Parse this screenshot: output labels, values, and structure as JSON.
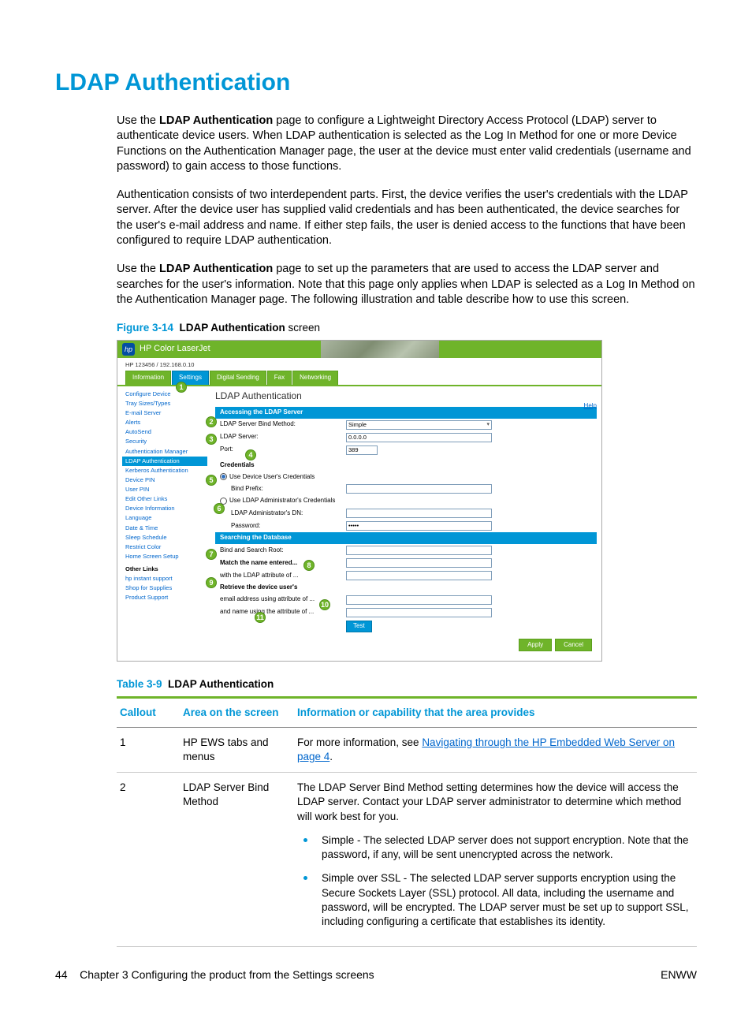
{
  "page": {
    "title": "LDAP Authentication",
    "para1_a": "Use the ",
    "para1_bold": "LDAP Authentication",
    "para1_b": " page to configure a Lightweight Directory Access Protocol (LDAP) server to authenticate device users. When LDAP authentication is selected as the Log In Method for one or more Device Functions on the Authentication Manager page, the user at the device must enter valid credentials (username and password) to gain access to those functions.",
    "para2": "Authentication consists of two interdependent parts. First, the device verifies the user's credentials with the LDAP server. After the device user has supplied valid credentials and has been authenticated, the device searches for the user's e-mail address and name. If either step fails, the user is denied access to the functions that have been configured to require LDAP authentication.",
    "para3_a": "Use the ",
    "para3_bold": "LDAP Authentication",
    "para3_b": " page to set up the parameters that are used to access the LDAP server and searches for the user's information. Note that this page only applies when LDAP is selected as a Log In Method on the Authentication Manager page. The following illustration and table describe how to use this screen."
  },
  "figure": {
    "caption_prefix": "Figure 3-14",
    "caption_bold": "LDAP Authentication",
    "caption_suffix": " screen",
    "header_product": "HP Color LaserJet",
    "subheader": "HP 123456 / 192.168.0.10",
    "tabs": [
      "Information",
      "Settings",
      "Digital Sending",
      "Fax",
      "Networking"
    ],
    "nav": [
      "Configure Device",
      "Tray Sizes/Types",
      "E-mail Server",
      "Alerts",
      "AutoSend",
      "Security",
      "Authentication Manager",
      "LDAP Authentication",
      "Kerberos Authentication",
      "Device PIN",
      "User PIN",
      "Edit Other Links",
      "Device Information",
      "Language",
      "Date & Time",
      "Sleep Schedule",
      "Restrict Color",
      "Home Screen Setup"
    ],
    "nav_current": "LDAP Authentication",
    "nav_otherlinks_header": "Other Links",
    "nav_otherlinks": [
      "hp instant support",
      "Shop for Supplies",
      "Product Support"
    ],
    "main_title": "LDAP Authentication",
    "help": "Help",
    "bar1": "Accessing the LDAP Server",
    "row_bind_method_label": "LDAP Server Bind Method:",
    "row_bind_method_value": "Simple",
    "row_server_label": "LDAP Server:",
    "row_server_value": "0.0.0.0",
    "row_port_label": "Port:",
    "row_port_value": "389",
    "credentials_header": "Credentials",
    "radio1": "Use Device User's Credentials",
    "bind_prefix": "Bind Prefix:",
    "radio2": "Use LDAP Administrator's Credentials",
    "admin_dn": "LDAP Administrator's DN:",
    "password_label": "Password:",
    "password_value": "•••••",
    "bar2": "Searching the Database",
    "search_root": "Bind and Search Root:",
    "match_name_a": "Match the name entered...",
    "match_name_b": "with the LDAP attribute of ...",
    "retrieve_a": "Retrieve the device user's",
    "retrieve_b": "email address using attribute of ...",
    "retrieve_c": "and name using the attribute of ...",
    "test_btn": "Test",
    "apply_btn": "Apply",
    "cancel_btn": "Cancel",
    "callouts": [
      "1",
      "2",
      "3",
      "4",
      "5",
      "6",
      "7",
      "8",
      "9",
      "10",
      "11"
    ]
  },
  "table": {
    "caption_prefix": "Table 3-9",
    "caption_title": "LDAP Authentication",
    "h1": "Callout",
    "h2": "Area on the screen",
    "h3": "Information or capability that the area provides",
    "rows": [
      {
        "callout": "1",
        "area": "HP EWS tabs and menus",
        "info_a": "For more information, see ",
        "info_link": "Navigating through the HP Embedded Web Server on page 4",
        "info_b": "."
      },
      {
        "callout": "2",
        "area": "LDAP Server Bind Method",
        "info_main": "The LDAP Server Bind Method setting determines how the device will access the LDAP server. Contact your LDAP server administrator to determine which method will work best for you.",
        "bullets": [
          "Simple - The selected LDAP server does not support encryption. Note that the password, if any, will be sent unencrypted across the network.",
          "Simple over SSL - The selected LDAP server supports encryption using the Secure Sockets Layer (SSL) protocol. All data, including the username and password, will be encrypted. The LDAP server must be set up to support SSL, including configuring a certificate that establishes its identity."
        ]
      }
    ]
  },
  "footer": {
    "page_num": "44",
    "chapter": "Chapter 3   Configuring the product from the Settings screens",
    "right": "ENWW"
  }
}
